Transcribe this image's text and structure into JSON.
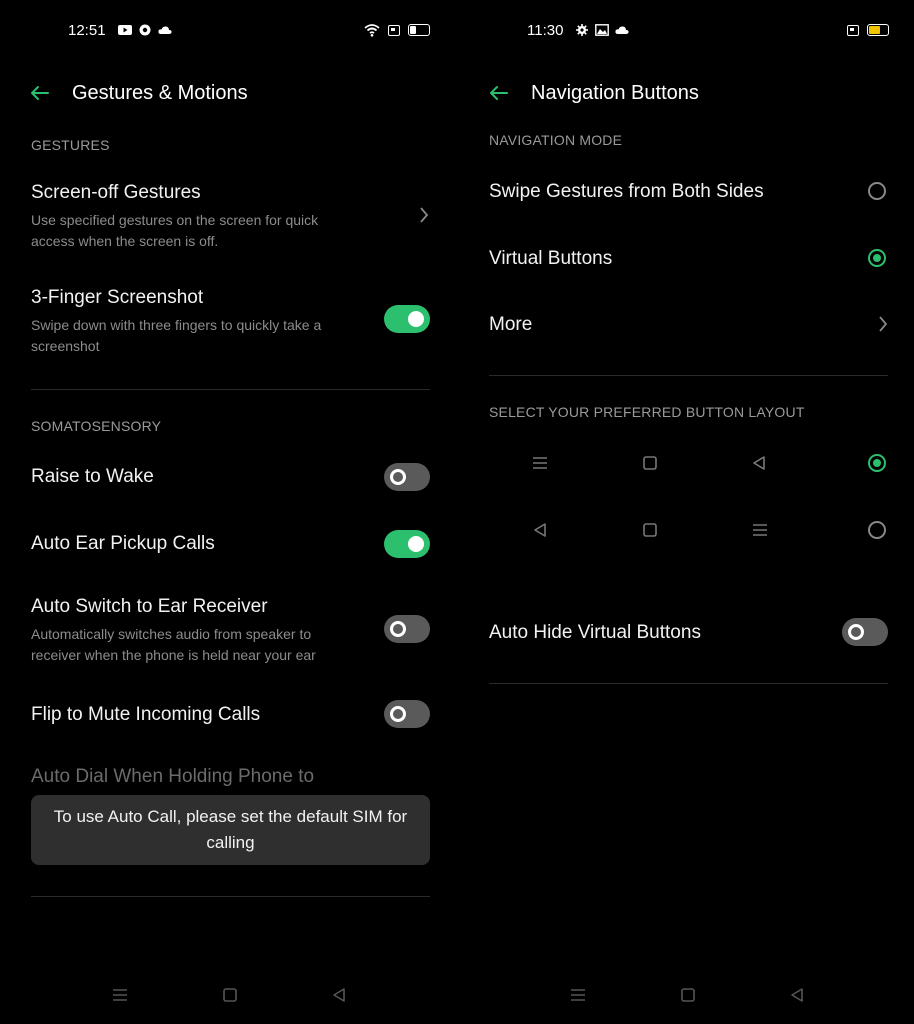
{
  "left": {
    "status": {
      "time": "12:51"
    },
    "header": {
      "title": "Gestures & Motions"
    },
    "sections": {
      "gestures": "GESTURES",
      "somatosensory": "SOMATOSENSORY"
    },
    "rows": {
      "screen_off": {
        "title": "Screen-off Gestures",
        "subtitle": "Use specified gestures on the screen for quick access when the screen is off."
      },
      "three_finger": {
        "title": "3-Finger Screenshot",
        "subtitle": "Swipe down with three fingers to quickly take a screenshot",
        "enabled": true
      },
      "raise_to_wake": {
        "title": "Raise to Wake",
        "enabled": false
      },
      "auto_ear_pickup": {
        "title": "Auto Ear Pickup Calls",
        "enabled": true
      },
      "auto_switch_ear": {
        "title": "Auto Switch to Ear Receiver",
        "subtitle": "Automatically switches audio from speaker to receiver when the phone is held near your ear",
        "enabled": false
      },
      "flip_to_mute": {
        "title": "Flip to Mute Incoming Calls",
        "enabled": false
      },
      "auto_dial": {
        "title": "Auto Dial When Holding Phone to"
      }
    },
    "toast": "To use Auto Call, please set the default SIM for calling"
  },
  "right": {
    "status": {
      "time": "11:30"
    },
    "header": {
      "title": "Navigation Buttons"
    },
    "sections": {
      "nav_mode": "NAVIGATION MODE",
      "layout": "SELECT YOUR PREFERRED BUTTON LAYOUT"
    },
    "rows": {
      "swipe_gestures": {
        "title": "Swipe Gestures from Both Sides",
        "selected": false
      },
      "virtual_buttons": {
        "title": "Virtual Buttons",
        "selected": true
      },
      "more": {
        "title": "More"
      },
      "layout_option_1": {
        "icons": [
          "menu-icon",
          "home-square-icon",
          "back-triangle-icon"
        ],
        "selected": true
      },
      "layout_option_2": {
        "icons": [
          "back-triangle-icon",
          "home-square-icon",
          "menu-icon"
        ],
        "selected": false
      },
      "auto_hide": {
        "title": "Auto Hide Virtual Buttons",
        "enabled": false
      }
    }
  },
  "colors": {
    "accent": "#2bbf6e",
    "background": "#000000",
    "toast": "#2f2f2f",
    "battery_right": "#f2c400"
  }
}
